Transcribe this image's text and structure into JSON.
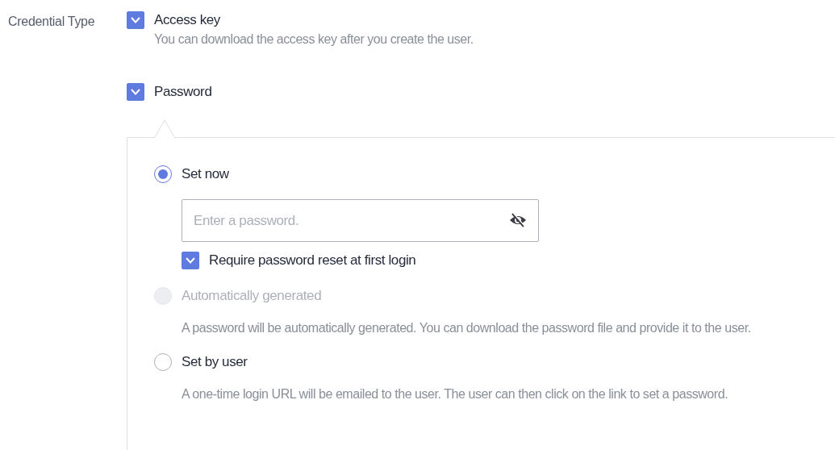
{
  "field_label": "Credential Type",
  "credentials": [
    {
      "label": "Access key",
      "checked": true,
      "description": "You can download the access key after you create the user."
    },
    {
      "label": "Password",
      "checked": true
    }
  ],
  "password_options": [
    {
      "label": "Set now",
      "selected": true,
      "disabled": false,
      "input": {
        "placeholder": "Enter a password."
      },
      "reset_checkbox": {
        "label": "Require password reset at first login",
        "checked": true
      }
    },
    {
      "label": "Automatically generated",
      "selected": false,
      "disabled": true,
      "description": "A password will be automatically generated. You can download the password file and provide it to the user."
    },
    {
      "label": "Set by user",
      "selected": false,
      "disabled": false,
      "description": "A one-time login URL will be emailed to the user. The user can then click on the link to set a password."
    }
  ]
}
